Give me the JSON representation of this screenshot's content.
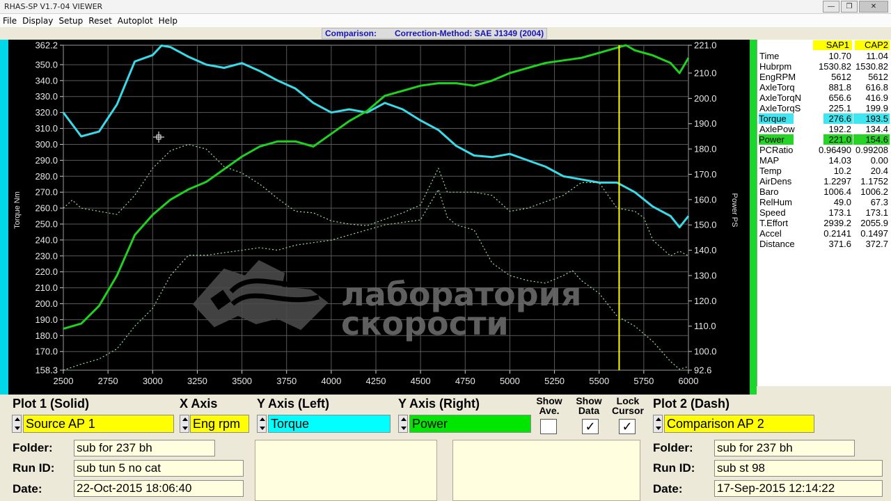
{
  "window": {
    "title": "RHAS-SP V1.7-04  VIEWER",
    "buttons": [
      "—",
      "❐",
      "✕"
    ]
  },
  "menu": [
    "File",
    "Display",
    "Setup",
    "Reset",
    "Autoplot",
    "Help"
  ],
  "header": {
    "comparison_label": "Comparison:",
    "correction": "Correction-Method: SAE J1349 (2004)"
  },
  "watermark": {
    "line1": "лаборатория",
    "line2": "скорости"
  },
  "chart_data": {
    "type": "line",
    "xlabel": "",
    "ylabel_left": "Torque Nm",
    "ylabel_right": "Power PS",
    "xlim": [
      2500,
      6000
    ],
    "ylim_left": [
      158.3,
      362.2
    ],
    "ylim_right": [
      92.6,
      221.0
    ],
    "x_ticks": [
      "2500",
      "2750",
      "3000",
      "3250",
      "3500",
      "3750",
      "4000",
      "4250",
      "4500",
      "4750",
      "5000",
      "5250",
      "5500",
      "5750",
      "6000"
    ],
    "y_ticks_left": [
      "362.2",
      "350.0",
      "340.0",
      "330.0",
      "320.0",
      "310.0",
      "300.0",
      "290.0",
      "280.0",
      "270.0",
      "260.0",
      "250.0",
      "240.0",
      "230.0",
      "220.0",
      "210.0",
      "200.0",
      "190.0",
      "180.0",
      "170.0",
      "158.3"
    ],
    "y_ticks_right": [
      "221.0",
      "210.0",
      "200.0",
      "190.0",
      "180.0",
      "170.0",
      "160.0",
      "150.0",
      "140.0",
      "130.0",
      "120.0",
      "110.0",
      "100.0",
      "92.6"
    ],
    "cursor_x": 5612,
    "grid": true,
    "series": [
      {
        "name": "Torque",
        "axis": "left",
        "style": "solid",
        "color": "#39dbe8",
        "x": [
          2500,
          2600,
          2700,
          2800,
          2900,
          3000,
          3050,
          3100,
          3200,
          3300,
          3400,
          3500,
          3600,
          3700,
          3800,
          3900,
          4000,
          4100,
          4200,
          4300,
          4400,
          4500,
          4600,
          4700,
          4800,
          4900,
          5000,
          5100,
          5200,
          5300,
          5400,
          5500,
          5600,
          5700,
          5800,
          5900,
          5950,
          6000
        ],
        "y": [
          320,
          305,
          308,
          325,
          352,
          356,
          362,
          361,
          355,
          350,
          348,
          351,
          346,
          340,
          335,
          326,
          320,
          322,
          320,
          326,
          322,
          315,
          309,
          299,
          293,
          292,
          294,
          290,
          286,
          280,
          278,
          276,
          276,
          270,
          261,
          255,
          248,
          255
        ]
      },
      {
        "name": "Power",
        "axis": "right",
        "style": "solid",
        "color": "#1fd21f",
        "x": [
          2500,
          2600,
          2700,
          2800,
          2900,
          3000,
          3100,
          3200,
          3300,
          3400,
          3500,
          3600,
          3700,
          3800,
          3900,
          4000,
          4100,
          4200,
          4300,
          4400,
          4500,
          4600,
          4700,
          4800,
          4900,
          5000,
          5100,
          5200,
          5300,
          5400,
          5500,
          5600,
          5650,
          5700,
          5800,
          5900,
          5950,
          6000
        ],
        "y": [
          109,
          111,
          118,
          130,
          146,
          154,
          160,
          164,
          167,
          172,
          177,
          181,
          183,
          183,
          181,
          186,
          191,
          195,
          201,
          203,
          205,
          206,
          206,
          205,
          207,
          210,
          212,
          214,
          215,
          216,
          218,
          220,
          221,
          219,
          217,
          214,
          210,
          216
        ]
      },
      {
        "name": "Torque",
        "axis": "left",
        "style": "dash",
        "color": "#9be0a0",
        "x": [
          2500,
          2550,
          2600,
          2700,
          2800,
          2900,
          3000,
          3100,
          3200,
          3300,
          3400,
          3500,
          3600,
          3700,
          3800,
          3900,
          4000,
          4100,
          4200,
          4300,
          4400,
          4500,
          4600,
          4650,
          4700,
          4800,
          4900,
          5000,
          5100,
          5200,
          5300,
          5400,
          5500,
          5600,
          5700,
          5750,
          5800,
          5900,
          5950,
          6000
        ],
        "y": [
          260,
          265,
          260,
          258,
          256,
          268,
          285,
          296,
          300,
          297,
          286,
          282,
          275,
          266,
          258,
          257,
          252,
          250,
          249,
          253,
          257,
          262,
          285,
          270,
          270,
          270,
          268,
          258,
          260,
          264,
          268,
          276,
          276,
          260,
          258,
          254,
          240,
          230,
          233,
          230
        ]
      },
      {
        "name": "Power",
        "axis": "right",
        "style": "dash",
        "color": "#9be0a0",
        "x": [
          2500,
          2600,
          2700,
          2800,
          2900,
          3000,
          3100,
          3200,
          3300,
          3400,
          3500,
          3600,
          3700,
          3800,
          3900,
          4000,
          4100,
          4200,
          4300,
          4400,
          4500,
          4600,
          4650,
          4700,
          4800,
          4900,
          5000,
          5100,
          5200,
          5300,
          5350,
          5400,
          5500,
          5600,
          5700,
          5800,
          5900,
          5950,
          6000
        ],
        "y": [
          92.6,
          95,
          97,
          101,
          110,
          117,
          130,
          138,
          138,
          139,
          140,
          141,
          140,
          142,
          143,
          144,
          146,
          148,
          150,
          151,
          152,
          164,
          153,
          150,
          148,
          135,
          130,
          128,
          127,
          130,
          132,
          128,
          123,
          114,
          110,
          104,
          96,
          93,
          94
        ]
      }
    ]
  },
  "data_panel": {
    "col_a": "SAP1",
    "col_b": "CAP2",
    "rows": [
      {
        "name": "Time",
        "a": "10.70",
        "b": "11.04"
      },
      {
        "name": "Hubrpm",
        "a": "1530.82",
        "b": "1530.82"
      },
      {
        "name": "EngRPM",
        "a": "5612",
        "b": "5612"
      },
      {
        "name": "AxleTorq",
        "a": "881.8",
        "b": "616.8"
      },
      {
        "name": "AxleTorqN",
        "a": "656.6",
        "b": "416.9"
      },
      {
        "name": "AxleTorqS",
        "a": "225.1",
        "b": "199.9"
      },
      {
        "name": "Torque",
        "a": "276.6",
        "b": "193.5",
        "highlight": "torque"
      },
      {
        "name": "AxlePow",
        "a": "192.2",
        "b": "134.4"
      },
      {
        "name": "Power",
        "a": "221.0",
        "b": "154.6",
        "highlight": "power"
      },
      {
        "name": "PCRatio",
        "a": "0.96490",
        "b": "0.99208"
      },
      {
        "name": "MAP",
        "a": "14.03",
        "b": "0.00"
      },
      {
        "name": "Temp",
        "a": "10.2",
        "b": "20.4"
      },
      {
        "name": "AirDens",
        "a": "1.2297",
        "b": "1.1752"
      },
      {
        "name": "Baro",
        "a": "1006.4",
        "b": "1006.2"
      },
      {
        "name": "RelHum",
        "a": "49.0",
        "b": "67.3"
      },
      {
        "name": "Speed",
        "a": "173.1",
        "b": "173.1"
      },
      {
        "name": "T.Effort",
        "a": "2939.2",
        "b": "2055.9"
      },
      {
        "name": "Accel",
        "a": "0.2141",
        "b": "0.1497"
      },
      {
        "name": "Distance",
        "a": "371.6",
        "b": "372.7"
      }
    ]
  },
  "controls": {
    "plot1_label": "Plot 1 (Solid)",
    "xaxis_label": "X Axis",
    "yleft_label": "Y Axis (Left)",
    "yright_label": "Y Axis (Right)",
    "show_ave_label": "Show Ave.",
    "show_data_label": "Show Data",
    "lock_cursor_label": "Lock Cursor",
    "plot2_label": "Plot 2 (Dash)",
    "plot1_value": "Source AP 1",
    "xaxis_value": "Eng rpm",
    "yleft_value": "Torque",
    "yright_value": "Power",
    "plot2_value": "Comparison AP 2",
    "show_ave_checked": "",
    "show_data_checked": "✓",
    "lock_cursor_checked": "✓"
  },
  "run1": {
    "folder_label": "Folder:",
    "runid_label": "Run ID:",
    "date_label": "Date:",
    "folder": "sub for 237 bh",
    "runid": "sub tun 5 no cat",
    "date": "22-Oct-2015  18:06:40"
  },
  "run2": {
    "folder_label": "Folder:",
    "runid_label": "Run ID:",
    "date_label": "Date:",
    "folder": "sub for 237 bh",
    "runid": "sub st 98",
    "date": "17-Sep-2015  12:14:22"
  }
}
